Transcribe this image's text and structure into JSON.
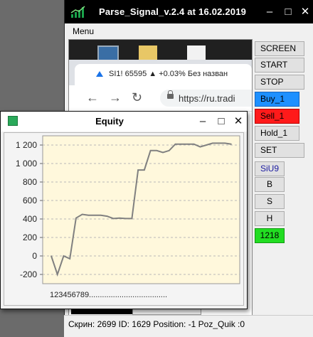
{
  "main_window": {
    "title": "Parse_Signal_v.2.4 at 16.02.2019",
    "menu": "Menu",
    "controls": {
      "minimize": "–",
      "maximize": "□",
      "close": "✕"
    }
  },
  "screen_capture": {
    "tab_title": "SI1! 65595 ▲ +0.03% Без назван",
    "url": "https://ru.tradi"
  },
  "buttons": [
    {
      "label": "SCREEN",
      "color": "#e1e1e1"
    },
    {
      "label": "START",
      "color": "#e1e1e1"
    },
    {
      "label": "STOP",
      "color": "#e1e1e1"
    },
    {
      "label": "Buy_1",
      "color": "#1e90ff"
    },
    {
      "label": "Sell_1",
      "color": "#ff1a1a"
    },
    {
      "label": "Hold_1",
      "color": "#e1e1e1"
    },
    {
      "label": "SET",
      "color": "#e1e1e1"
    },
    {
      "label": "SiU9",
      "color": "#e1e1e1"
    },
    {
      "label": "B",
      "color": "#e1e1e1"
    },
    {
      "label": "S",
      "color": "#e1e1e1"
    },
    {
      "label": "H",
      "color": "#e1e1e1"
    },
    {
      "label": "1218",
      "color": "#22dd22"
    }
  ],
  "status_bar": "Скрин: 2699 ID: 1629 Position: -1 Poz_Quik :0",
  "equity_window": {
    "title": "Equity",
    "controls": {
      "minimize": "–",
      "maximize": "□",
      "close": "✕"
    }
  },
  "chart_data": {
    "type": "line",
    "title": "",
    "xlabel": "",
    "ylabel": "",
    "x_tick_text": "123456789....................................",
    "yticks": [
      -200,
      0,
      200,
      400,
      600,
      800,
      1000,
      1200
    ],
    "ytick_labels": [
      "-200",
      "0",
      "200",
      "400",
      "600",
      "800",
      "1 000",
      "1 200"
    ],
    "ylim": [
      -300,
      1300
    ],
    "grid": true,
    "background": "#fff8dc",
    "line_color": "#808080",
    "series": [
      {
        "values": [
          0,
          -200,
          0,
          -30,
          410,
          450,
          440,
          440,
          440,
          430,
          405,
          410,
          405,
          405,
          930,
          930,
          1140,
          1140,
          1120,
          1140,
          1210,
          1210,
          1210,
          1210,
          1180,
          1200,
          1220,
          1220,
          1220,
          1210
        ]
      }
    ]
  }
}
